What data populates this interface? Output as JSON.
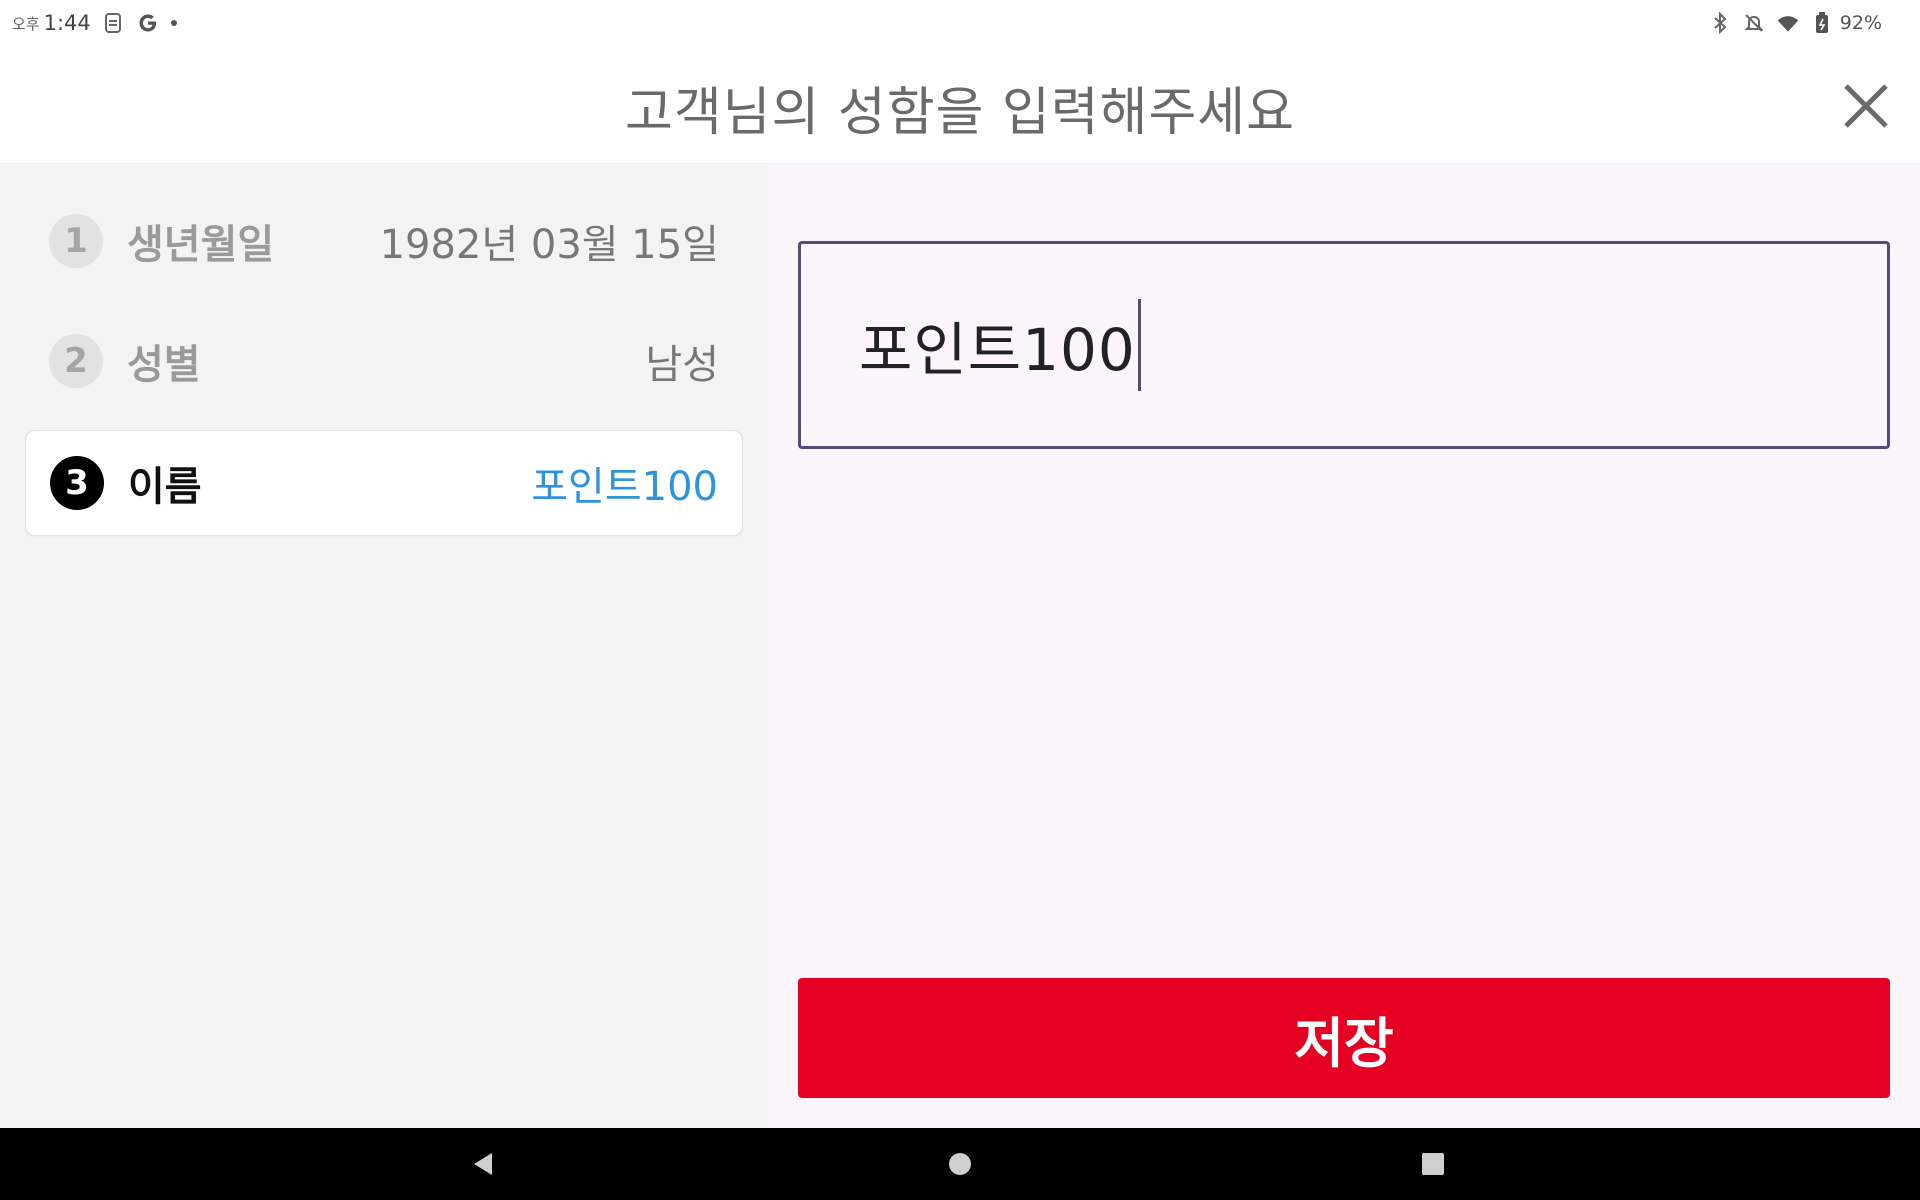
{
  "status_bar": {
    "ampm": "오후",
    "time": "1:44",
    "icons_left": [
      "sim-icon",
      "google-icon",
      "notification-dot"
    ],
    "icons_right": [
      "bluetooth-icon",
      "mute-icon",
      "wifi-icon",
      "battery-icon"
    ],
    "battery_percent": "92%"
  },
  "header": {
    "title": "고객님의 성함을 입력해주세요",
    "close_icon": "close-icon"
  },
  "steps": [
    {
      "number": "1",
      "label": "생년월일",
      "value": "1982년 03월 15일",
      "active": false
    },
    {
      "number": "2",
      "label": "성별",
      "value": "남성",
      "active": false
    },
    {
      "number": "3",
      "label": "이름",
      "value": "포인트100",
      "active": true
    }
  ],
  "name_input": {
    "value": "포인트100"
  },
  "save_button": {
    "label": "저장"
  },
  "nav_bar": {
    "icons": [
      "back-icon",
      "home-icon",
      "recents-icon"
    ]
  },
  "colors": {
    "accent_red": "#e60023",
    "active_value_blue": "#2f93dd",
    "input_border": "#5b4a78",
    "right_panel_bg": "#fcf5fc",
    "left_panel_bg": "#f3f3f3"
  }
}
